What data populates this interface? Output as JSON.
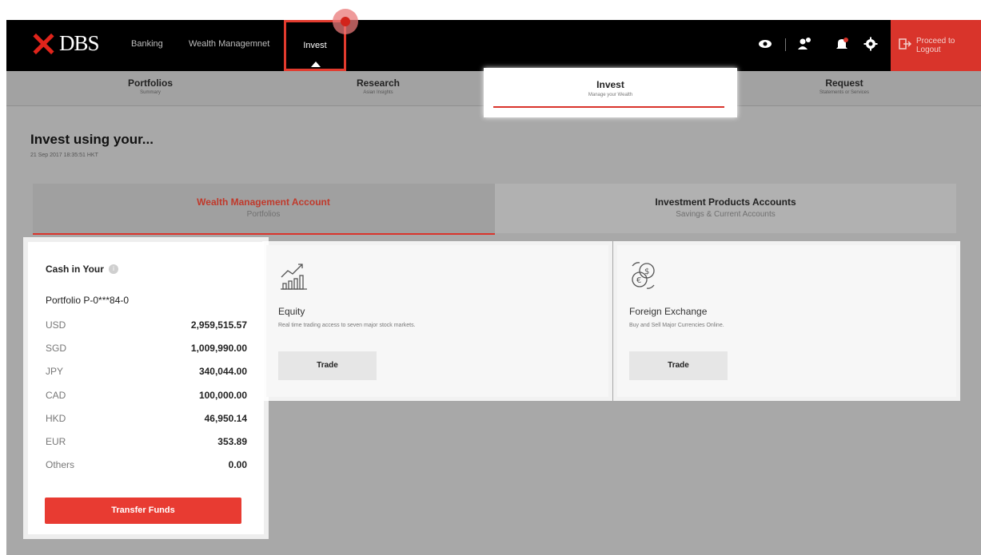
{
  "topbar": {
    "brand": "DBS",
    "nav": [
      "Banking",
      "Wealth Managemnet",
      "Invest"
    ],
    "icons": [
      "eye-icon",
      "user-add-icon",
      "bell-icon",
      "gear-icon"
    ],
    "logout_label_1": "Proceed to",
    "logout_label_2": "Logout"
  },
  "subtabs": [
    {
      "title": "Portfolios",
      "subtitle": "Summary"
    },
    {
      "title": "Research",
      "subtitle": "Asian Insights"
    },
    {
      "title": "Invest",
      "subtitle": "Manage your Wealth"
    },
    {
      "title": "Request",
      "subtitle": "Statements or Services"
    }
  ],
  "page": {
    "title": "Invest using your...",
    "timestamp": "21 Sep 2017 18:35:51 HKT"
  },
  "accounts": [
    {
      "title": "Wealth Management Account",
      "subtitle": "Portfolios"
    },
    {
      "title": "Investment Products Accounts",
      "subtitle": "Savings & Current Accounts"
    }
  ],
  "cash": {
    "title": "Cash in Your",
    "portfolio": "Portfolio P-0***84-0",
    "rows": [
      {
        "currency": "USD",
        "value": "2,959,515.57"
      },
      {
        "currency": "SGD",
        "value": "1,009,990.00"
      },
      {
        "currency": "JPY",
        "value": "340,044.00"
      },
      {
        "currency": "CAD",
        "value": "100,000.00"
      },
      {
        "currency": "HKD",
        "value": "46,950.14"
      },
      {
        "currency": "EUR",
        "value": "353.89"
      },
      {
        "currency": "Others",
        "value": "0.00"
      }
    ],
    "transfer_label": "Transfer Funds"
  },
  "products": [
    {
      "name": "Equity",
      "desc": "Real time trading access to seven major stock markets.",
      "button": "Trade"
    },
    {
      "name": "Foreign Exchange",
      "desc": "Buy and Sell Major Currencies Online.",
      "button": "Trade"
    }
  ],
  "colors": {
    "accent": "#d9342b",
    "topbar": "#000000",
    "overlay": "#a8a8a8"
  }
}
